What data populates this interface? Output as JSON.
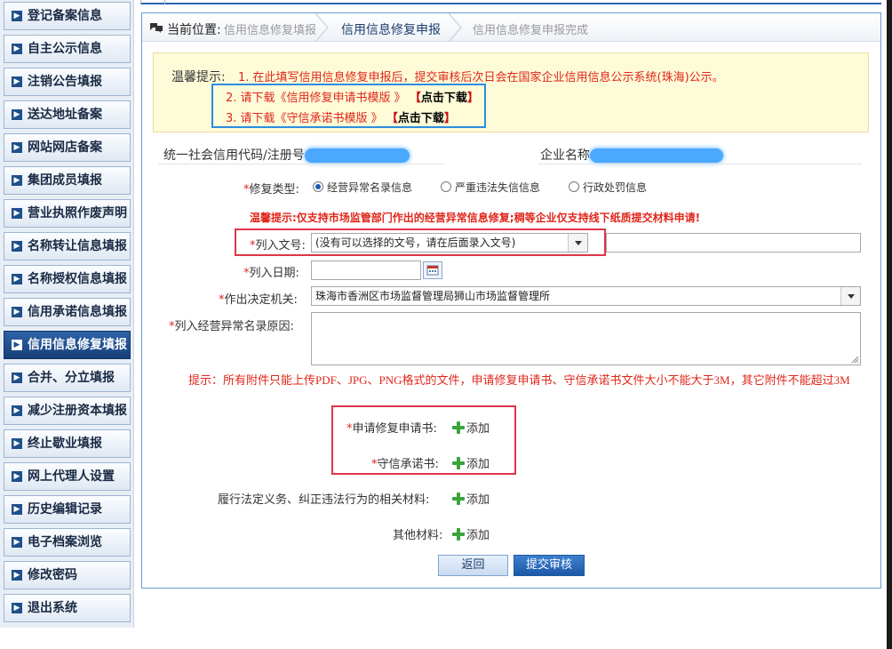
{
  "sidebar": {
    "items": [
      {
        "label": "登记备案信息"
      },
      {
        "label": "自主公示信息"
      },
      {
        "label": "注销公告填报"
      },
      {
        "label": "送达地址备案"
      },
      {
        "label": "网站网店备案"
      },
      {
        "label": "集团成员填报"
      },
      {
        "label": "营业执照作废声明"
      },
      {
        "label": "名称转让信息填报"
      },
      {
        "label": "名称授权信息填报"
      },
      {
        "label": "信用承诺信息填报"
      },
      {
        "label": "信用信息修复填报"
      },
      {
        "label": "合并、分立填报"
      },
      {
        "label": "减少注册资本填报"
      },
      {
        "label": "终止歇业填报"
      },
      {
        "label": "网上代理人设置"
      },
      {
        "label": "历史编辑记录"
      },
      {
        "label": "电子档案浏览"
      },
      {
        "label": "修改密码"
      },
      {
        "label": "退出系统"
      }
    ],
    "active_index": 10
  },
  "breadcrumb": {
    "label": "当前位置:",
    "steps": [
      "信用信息修复填报",
      "信用信息修复申报",
      "信用信息修复申报完成"
    ]
  },
  "notice": {
    "title": "温馨提示:",
    "line1": "1. 在此填写信用信息修复申报后，提交审核后次日会在国家企业信用信息公示系统(珠海)公示。",
    "line2": "2. 请下载《信用修复申请书模版 》",
    "line3": "3. 请下载《守信承诺书模版 》",
    "download_label": "点击下载"
  },
  "company": {
    "code_label": "统一社会信用代码/注册号",
    "name_label": "企业名称"
  },
  "form": {
    "repair_type_label": "修复类型:",
    "repair_type_options": [
      "经营异常名录信息",
      "严重违法失信信息",
      "行政处罚信息"
    ],
    "repair_type_selected": 0,
    "warning": "温馨提示:仅支持市场监管部门作出的经营异常信息修复;稠等企业仅支持线下纸质提交材料申请!",
    "doc_no_label": "列入文号:",
    "doc_no_selected": "(没有可以选择的文号，请在后面录入文号)",
    "date_label": "列入日期:",
    "authority_label": "作出决定机关:",
    "authority_value": "珠海市香洲区市场监督管理局狮山市场监督管理所",
    "reason_label": "列入经营异常名录原因:",
    "attach_hint": "提示：所有附件只能上传PDF、JPG、PNG格式的文件，申请修复申请书、守信承诺书文件大小不能大于3M，其它附件不能超过3M",
    "attachments": [
      {
        "label": "申请修复申请书:",
        "required": true
      },
      {
        "label": "守信承诺书:",
        "required": true
      },
      {
        "label": "履行法定义务、纠正违法行为的相关材料:",
        "required": false
      },
      {
        "label": "其他材料:",
        "required": false
      }
    ],
    "add_label": "添加"
  },
  "buttons": {
    "back": "返回",
    "submit": "提交审核"
  }
}
